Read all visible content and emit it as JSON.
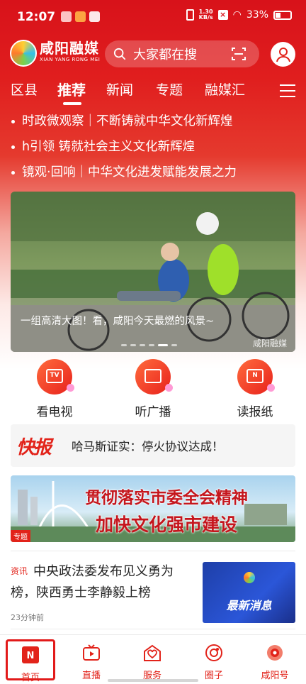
{
  "status_bar": {
    "time": "12:07",
    "network_speed_value": "1.30",
    "network_speed_unit": "KB/s",
    "battery": "33%"
  },
  "brand": {
    "name": "咸阳融媒",
    "pinyin": "XIAN YANG RONG MEI"
  },
  "search": {
    "placeholder": "大家都在搜"
  },
  "tabs": [
    {
      "label": "区县"
    },
    {
      "label": "推荐"
    },
    {
      "label": "新闻"
    },
    {
      "label": "专题"
    },
    {
      "label": "融媒汇"
    }
  ],
  "headlines": [
    "时政微观察｜不断铸就中华文化新辉煌",
    "h引领 铸就社会主义文化新辉煌",
    "镜观·回响｜中华文化进发赋能发展之力"
  ],
  "banner": {
    "caption": "一组高清大图！看，咸阳今天最燃的风景~",
    "watermark": "咸阳融媒",
    "slide_count": 6,
    "active_slide": 5
  },
  "quick_entries": [
    {
      "label": "看电视",
      "icon": "tv-icon",
      "glyph": "TV"
    },
    {
      "label": "听广播",
      "icon": "radio-icon",
      "glyph": ""
    },
    {
      "label": "读报纸",
      "icon": "newspaper-icon",
      "glyph": "N"
    }
  ],
  "flash_news": {
    "tag": "快报",
    "text": "哈马斯证实：停火协议达成！"
  },
  "special_banner": {
    "line1": "贯彻落实市委全会精神",
    "line2": "加快文化强市建设",
    "badge": "专题"
  },
  "news_item": {
    "tag": "资讯",
    "title": "中央政法委发布见义勇为榜，陕西勇士李静毅上榜",
    "time": "23分钟前",
    "thumb_text": "最新消息"
  },
  "bottom_nav": [
    {
      "label": "首页",
      "icon": "home-icon",
      "active": true
    },
    {
      "label": "直播",
      "icon": "live-tv-icon",
      "active": false
    },
    {
      "label": "服务",
      "icon": "service-heart-icon",
      "active": false
    },
    {
      "label": "圈子",
      "icon": "circle-icon",
      "active": false
    },
    {
      "label": "咸阳号",
      "icon": "xianyang-logo-icon",
      "active": false
    }
  ],
  "colors": {
    "brand_red": "#e2231a",
    "header_red": "#d8121a"
  }
}
